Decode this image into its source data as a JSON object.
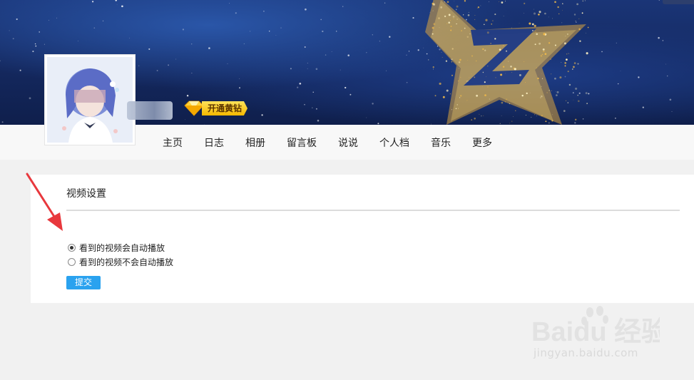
{
  "banner": {
    "top_text": "·  ·   ·  ·  ·  ·",
    "vip_label": "开通黄钻"
  },
  "nav": {
    "items": [
      "主页",
      "日志",
      "相册",
      "留言板",
      "说说",
      "个人档",
      "音乐",
      "更多"
    ]
  },
  "settings": {
    "title": "视频设置",
    "options": [
      {
        "label": "看到的视频会自动播放",
        "selected": true
      },
      {
        "label": "看到的视频不会自动播放",
        "selected": false
      }
    ],
    "submit_label": "提交"
  },
  "watermark": {
    "brand": "Baidu 经验",
    "url": "jingyan.baidu.com"
  },
  "colors": {
    "banner_blue": "#14285e",
    "submit_blue": "#2aa2ef",
    "vip_gold": "#f6b800",
    "arrow_red": "#e8383d"
  }
}
